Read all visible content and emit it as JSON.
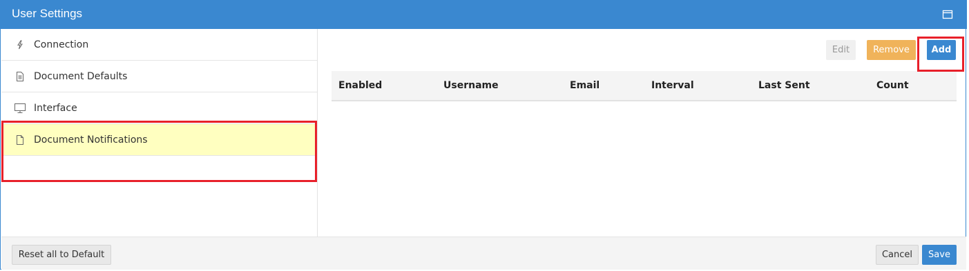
{
  "window": {
    "title": "User Settings",
    "maximize_icon": "window-maximize-icon"
  },
  "sidebar": {
    "items": [
      {
        "label": "Connection",
        "icon": "lightning-icon"
      },
      {
        "label": "Document Defaults",
        "icon": "document-lines-icon"
      },
      {
        "label": "Interface",
        "icon": "monitor-icon"
      },
      {
        "label": "Document Notifications",
        "icon": "document-icon",
        "active": true
      }
    ]
  },
  "toolbar": {
    "edit_label": "Edit",
    "remove_label": "Remove",
    "add_label": "Add"
  },
  "table": {
    "columns": [
      "Enabled",
      "Username",
      "Email",
      "Interval",
      "Last Sent",
      "Count"
    ],
    "rows": []
  },
  "footer": {
    "reset_label": "Reset all to Default",
    "cancel_label": "Cancel",
    "save_label": "Save"
  },
  "colors": {
    "accent": "#3a88d0",
    "warning": "#f0b35a",
    "active_row": "#ffffc0",
    "highlight": "#e8202a"
  }
}
